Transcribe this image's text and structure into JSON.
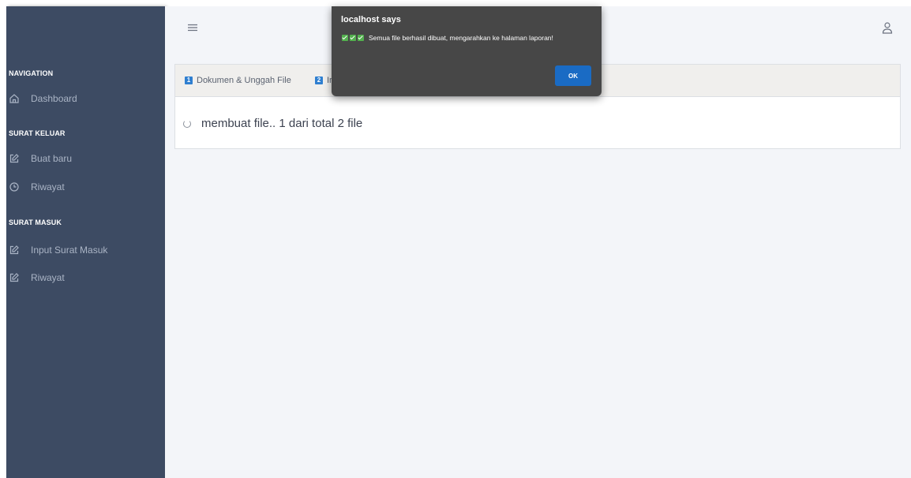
{
  "sidebar": {
    "sections": [
      {
        "heading": "NAVIGATION",
        "items": [
          {
            "label": "Dashboard",
            "icon": "home-icon"
          }
        ]
      },
      {
        "heading": "SURAT KELUAR",
        "items": [
          {
            "label": "Buat baru",
            "icon": "edit-icon"
          },
          {
            "label": "Riwayat",
            "icon": "clock-icon"
          }
        ]
      },
      {
        "heading": "SURAT MASUK",
        "items": [
          {
            "label": "Input Surat Masuk",
            "icon": "edit-icon"
          },
          {
            "label": "Riwayat",
            "icon": "edit-icon"
          }
        ]
      }
    ]
  },
  "topbar": {
    "menu_icon": "hamburger-icon",
    "user_icon": "user-icon"
  },
  "tabs": [
    {
      "number": "1",
      "label": "Dokumen & Unggah File"
    },
    {
      "number": "2",
      "label": "Ir"
    }
  ],
  "progress": {
    "text": "membuat file.. 1 dari total 2 file"
  },
  "dialog": {
    "title": "localhost says",
    "message": "Semua file berhasil dibuat, mengarahkan ke halaman laporan!",
    "ok_label": "OK"
  },
  "colors": {
    "sidebar_bg": "#3d4b63",
    "main_bg": "#f3f5f9",
    "dialog_bg": "#474747",
    "accent": "#1a6bc4",
    "check_green": "#53b04e"
  }
}
